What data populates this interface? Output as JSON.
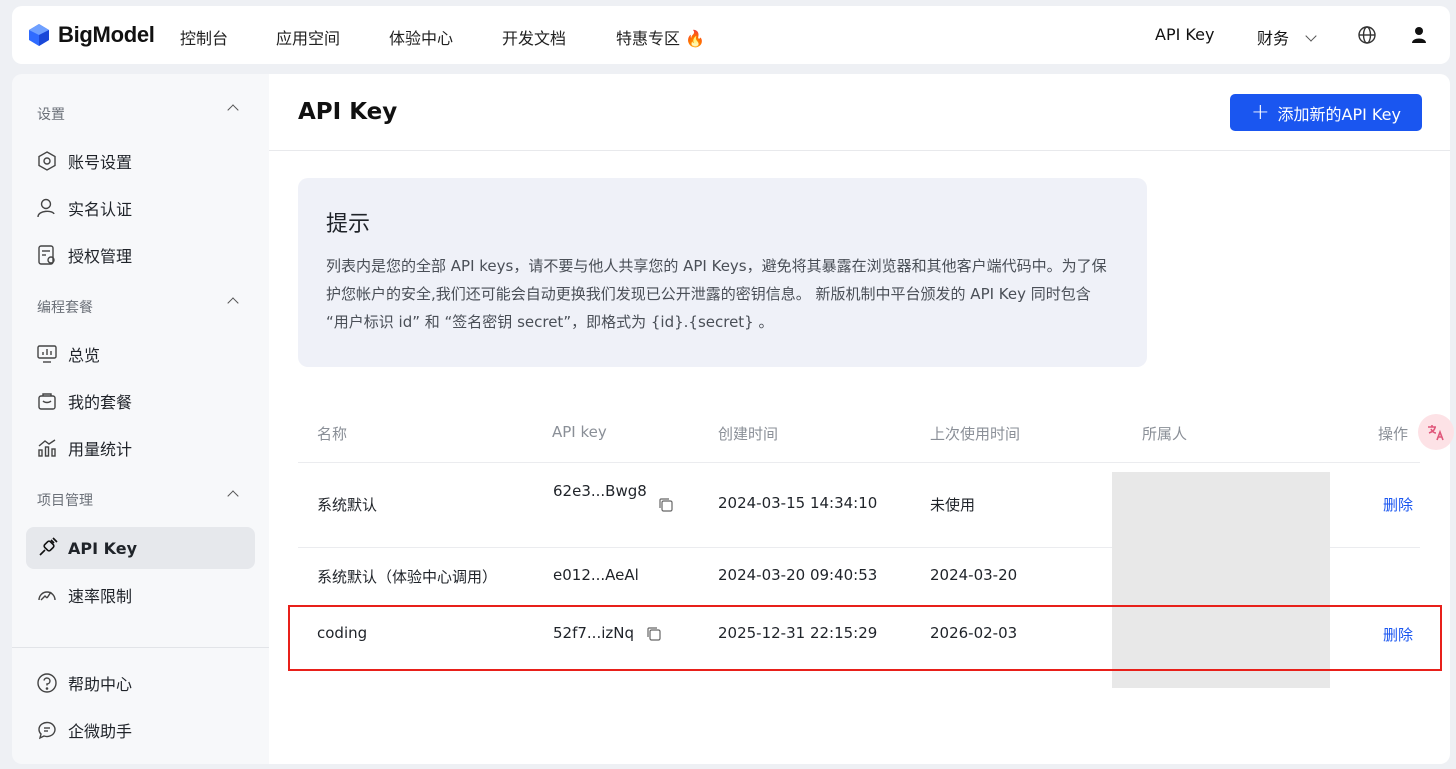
{
  "brand": {
    "name": "BigModel",
    "accent": "#1a56f0"
  },
  "nav": {
    "items": [
      "控制台",
      "应用空间",
      "体验中心",
      "开发文档",
      "特惠专区 🔥"
    ],
    "api_key": "API Key",
    "finance": "财务"
  },
  "sidebar": {
    "sections": [
      {
        "title": "设置",
        "items": [
          "账号设置",
          "实名认证",
          "授权管理"
        ]
      },
      {
        "title": "编程套餐",
        "items": [
          "总览",
          "我的套餐",
          "用量统计"
        ]
      },
      {
        "title": "项目管理",
        "items": [
          "API Key",
          "速率限制"
        ]
      }
    ],
    "footer": [
      "帮助中心",
      "企微助手"
    ]
  },
  "main": {
    "title": "API Key",
    "add_button": "添加新的API Key",
    "tip": {
      "title": "提示",
      "text": "列表内是您的全部 API keys，请不要与他人共享您的 API Keys，避免将其暴露在浏览器和其他客户端代码中。为了保护您帐户的安全,我们还可能会自动更换我们发现已公开泄露的密钥信息。 新版机制中平台颁发的 API Key 同时包含 “用户标识 id” 和 “签名密钥 secret”，即格式为 {id}.{secret} 。"
    },
    "table": {
      "headers": [
        "名称",
        "API key",
        "创建时间",
        "上次使用时间",
        "所属人",
        "操作"
      ],
      "rows": [
        {
          "name": "系统默认",
          "key": "62e3...Bwg8",
          "created": "2024-03-15 14:34:10",
          "last_used": "未使用",
          "action": "删除"
        },
        {
          "name": "系统默认（体验中心调用）",
          "key": "e012...AeAl",
          "created": "2024-03-20 09:40:53",
          "last_used": "2024-03-20",
          "action": ""
        },
        {
          "name": "coding",
          "key": "52f7...izNq",
          "created": "2025-12-31 22:15:29",
          "last_used": "2026-02-03",
          "action": "删除"
        }
      ]
    }
  },
  "colors": {
    "highlight": "#e8201a",
    "primary": "#1a56f0"
  }
}
